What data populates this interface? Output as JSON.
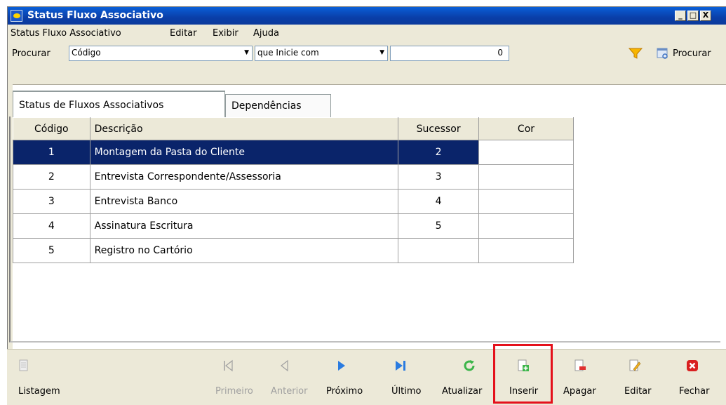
{
  "window": {
    "title": "Status Fluxo Associativo",
    "controls": [
      "_",
      "□",
      "X"
    ]
  },
  "menu": [
    "Status Fluxo Associativo",
    "Editar",
    "Exibir",
    "Ajuda"
  ],
  "search": {
    "label": "Procurar",
    "field_value": "Código",
    "operator_value": "que Inicie com",
    "term_value": "0",
    "search_button": "Procurar"
  },
  "tabs": [
    {
      "label": "Status de Fluxos Associativos",
      "active": true
    },
    {
      "label": "Dependências",
      "active": false
    }
  ],
  "table": {
    "columns": [
      "Código",
      "Descrição",
      "Sucessor",
      "Cor"
    ],
    "rows": [
      {
        "codigo": "1",
        "descricao": "Montagem da Pasta do Cliente",
        "sucessor": "2",
        "cor": "",
        "selected": true
      },
      {
        "codigo": "2",
        "descricao": "Entrevista Correspondente/Assessoria",
        "sucessor": "3",
        "cor": ""
      },
      {
        "codigo": "3",
        "descricao": "Entrevista Banco",
        "sucessor": "4",
        "cor": ""
      },
      {
        "codigo": "4",
        "descricao": "Assinatura Escritura",
        "sucessor": "5",
        "cor": ""
      },
      {
        "codigo": "5",
        "descricao": "Registro no Cartório",
        "sucessor": "",
        "cor": ""
      }
    ]
  },
  "toolbar": {
    "listagem": "Listagem",
    "primeiro": "Primeiro",
    "anterior": "Anterior",
    "proximo": "Próximo",
    "ultimo": "Último",
    "atualizar": "Atualizar",
    "inserir": "Inserir",
    "apagar": "Apagar",
    "editar": "Editar",
    "fechar": "Fechar"
  },
  "colors": {
    "titlebar": "#0a3ea8",
    "selection": "#0a246a",
    "highlight": "#e4111b"
  }
}
